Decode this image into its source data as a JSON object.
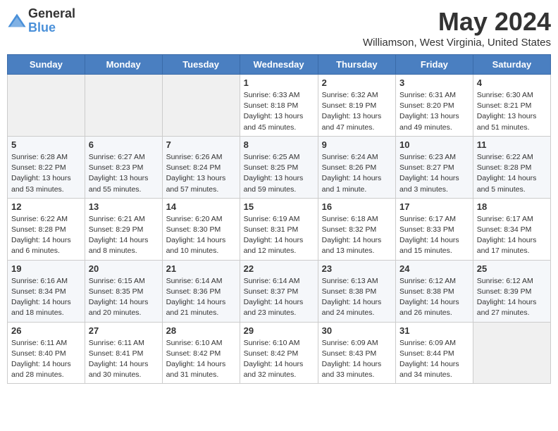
{
  "header": {
    "logo_general": "General",
    "logo_blue": "Blue",
    "month_title": "May 2024",
    "location": "Williamson, West Virginia, United States"
  },
  "weekdays": [
    "Sunday",
    "Monday",
    "Tuesday",
    "Wednesday",
    "Thursday",
    "Friday",
    "Saturday"
  ],
  "weeks": [
    [
      null,
      null,
      null,
      {
        "day": 1,
        "sunrise": "6:33 AM",
        "sunset": "8:18 PM",
        "daylight": "13 hours and 45 minutes."
      },
      {
        "day": 2,
        "sunrise": "6:32 AM",
        "sunset": "8:19 PM",
        "daylight": "13 hours and 47 minutes."
      },
      {
        "day": 3,
        "sunrise": "6:31 AM",
        "sunset": "8:20 PM",
        "daylight": "13 hours and 49 minutes."
      },
      {
        "day": 4,
        "sunrise": "6:30 AM",
        "sunset": "8:21 PM",
        "daylight": "13 hours and 51 minutes."
      }
    ],
    [
      {
        "day": 5,
        "sunrise": "6:28 AM",
        "sunset": "8:22 PM",
        "daylight": "13 hours and 53 minutes."
      },
      {
        "day": 6,
        "sunrise": "6:27 AM",
        "sunset": "8:23 PM",
        "daylight": "13 hours and 55 minutes."
      },
      {
        "day": 7,
        "sunrise": "6:26 AM",
        "sunset": "8:24 PM",
        "daylight": "13 hours and 57 minutes."
      },
      {
        "day": 8,
        "sunrise": "6:25 AM",
        "sunset": "8:25 PM",
        "daylight": "13 hours and 59 minutes."
      },
      {
        "day": 9,
        "sunrise": "6:24 AM",
        "sunset": "8:26 PM",
        "daylight": "14 hours and 1 minute."
      },
      {
        "day": 10,
        "sunrise": "6:23 AM",
        "sunset": "8:27 PM",
        "daylight": "14 hours and 3 minutes."
      },
      {
        "day": 11,
        "sunrise": "6:22 AM",
        "sunset": "8:28 PM",
        "daylight": "14 hours and 5 minutes."
      }
    ],
    [
      {
        "day": 12,
        "sunrise": "6:22 AM",
        "sunset": "8:28 PM",
        "daylight": "14 hours and 6 minutes."
      },
      {
        "day": 13,
        "sunrise": "6:21 AM",
        "sunset": "8:29 PM",
        "daylight": "14 hours and 8 minutes."
      },
      {
        "day": 14,
        "sunrise": "6:20 AM",
        "sunset": "8:30 PM",
        "daylight": "14 hours and 10 minutes."
      },
      {
        "day": 15,
        "sunrise": "6:19 AM",
        "sunset": "8:31 PM",
        "daylight": "14 hours and 12 minutes."
      },
      {
        "day": 16,
        "sunrise": "6:18 AM",
        "sunset": "8:32 PM",
        "daylight": "14 hours and 13 minutes."
      },
      {
        "day": 17,
        "sunrise": "6:17 AM",
        "sunset": "8:33 PM",
        "daylight": "14 hours and 15 minutes."
      },
      {
        "day": 18,
        "sunrise": "6:17 AM",
        "sunset": "8:34 PM",
        "daylight": "14 hours and 17 minutes."
      }
    ],
    [
      {
        "day": 19,
        "sunrise": "6:16 AM",
        "sunset": "8:34 PM",
        "daylight": "14 hours and 18 minutes."
      },
      {
        "day": 20,
        "sunrise": "6:15 AM",
        "sunset": "8:35 PM",
        "daylight": "14 hours and 20 minutes."
      },
      {
        "day": 21,
        "sunrise": "6:14 AM",
        "sunset": "8:36 PM",
        "daylight": "14 hours and 21 minutes."
      },
      {
        "day": 22,
        "sunrise": "6:14 AM",
        "sunset": "8:37 PM",
        "daylight": "14 hours and 23 minutes."
      },
      {
        "day": 23,
        "sunrise": "6:13 AM",
        "sunset": "8:38 PM",
        "daylight": "14 hours and 24 minutes."
      },
      {
        "day": 24,
        "sunrise": "6:12 AM",
        "sunset": "8:38 PM",
        "daylight": "14 hours and 26 minutes."
      },
      {
        "day": 25,
        "sunrise": "6:12 AM",
        "sunset": "8:39 PM",
        "daylight": "14 hours and 27 minutes."
      }
    ],
    [
      {
        "day": 26,
        "sunrise": "6:11 AM",
        "sunset": "8:40 PM",
        "daylight": "14 hours and 28 minutes."
      },
      {
        "day": 27,
        "sunrise": "6:11 AM",
        "sunset": "8:41 PM",
        "daylight": "14 hours and 30 minutes."
      },
      {
        "day": 28,
        "sunrise": "6:10 AM",
        "sunset": "8:42 PM",
        "daylight": "14 hours and 31 minutes."
      },
      {
        "day": 29,
        "sunrise": "6:10 AM",
        "sunset": "8:42 PM",
        "daylight": "14 hours and 32 minutes."
      },
      {
        "day": 30,
        "sunrise": "6:09 AM",
        "sunset": "8:43 PM",
        "daylight": "14 hours and 33 minutes."
      },
      {
        "day": 31,
        "sunrise": "6:09 AM",
        "sunset": "8:44 PM",
        "daylight": "14 hours and 34 minutes."
      },
      null
    ]
  ]
}
